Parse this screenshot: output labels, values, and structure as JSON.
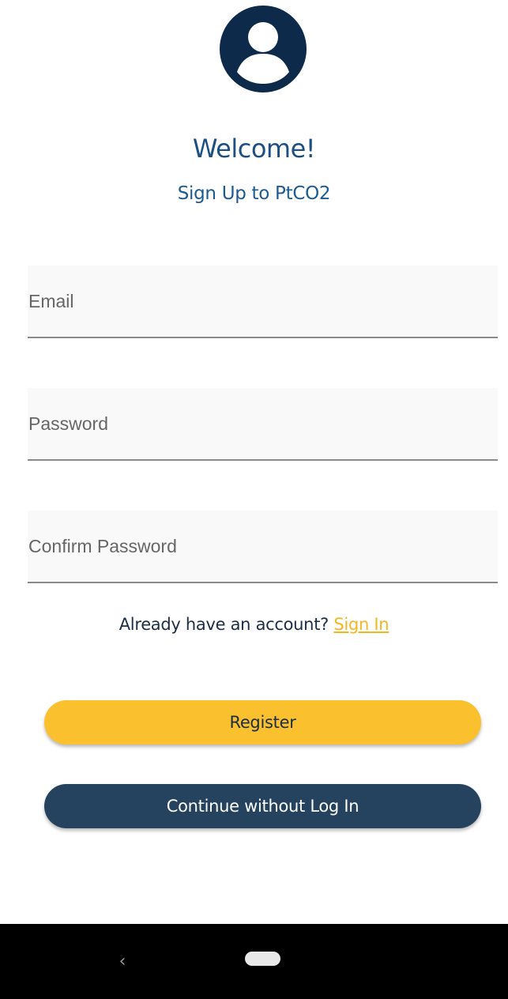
{
  "header": {
    "avatar_icon": "account-circle-icon",
    "welcome": "Welcome!",
    "subtitle": "Sign Up to PtCO2"
  },
  "form": {
    "email_placeholder": "Email",
    "email_value": "",
    "password_placeholder": "Password",
    "password_value": "",
    "confirm_placeholder": "Confirm Password",
    "confirm_value": ""
  },
  "signin": {
    "prompt": "Already have an account?",
    "link_label": "Sign In"
  },
  "actions": {
    "register_label": "Register",
    "continue_label": "Continue without Log In"
  },
  "colors": {
    "brand_navy": "#0d2a4b",
    "title_blue": "#1d4f82",
    "accent_yellow": "#fbc02d",
    "link_yellow": "#f6b622",
    "button_navy": "#25435f"
  },
  "system_nav": {
    "back_icon": "chevron-left-icon",
    "home_icon": "home-pill-icon"
  }
}
